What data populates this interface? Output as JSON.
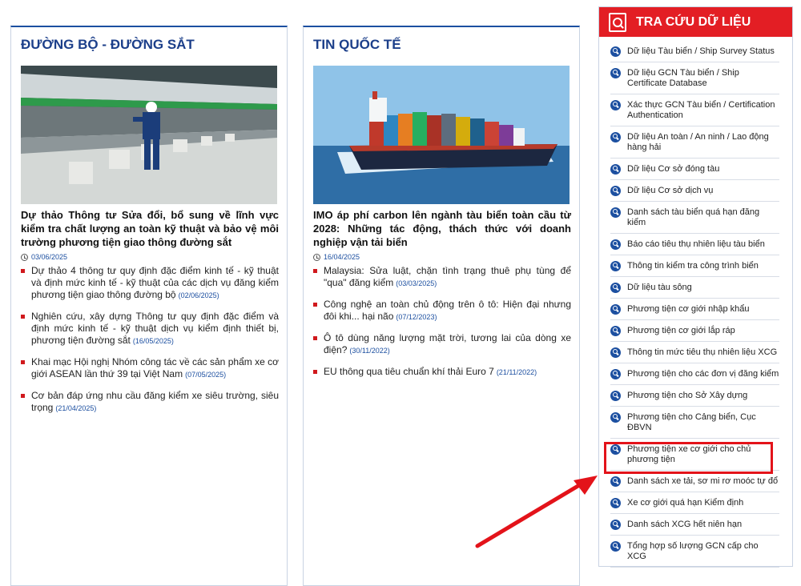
{
  "road_rail": {
    "title": "ĐƯỜNG BỘ - ĐƯỜNG SẮT",
    "lead_title": "Dự thảo Thông tư Sửa đổi, bổ sung về lĩnh vực kiểm tra chất lượng an toàn kỹ thuật và bảo vệ môi trường phương tiện giao thông đường sắt",
    "lead_date": "03/06/2025",
    "items": [
      {
        "text": "Dự thảo 4 thông tư quy định đặc điểm kinh tế - kỹ thuật và định mức kinh tế - kỹ thuật của các dịch vụ đăng kiểm phương tiện giao thông đường bộ",
        "date": "(02/06/2025)"
      },
      {
        "text": "Nghiên cứu, xây dựng Thông tư quy định đặc điểm và định mức kinh tế - kỹ thuật dịch vụ kiểm định thiết bị, phương tiện đường sắt",
        "date": "(16/05/2025)"
      },
      {
        "text": "Khai mạc Hội nghị Nhóm công tác về các sản phẩm xe cơ giới ASEAN lần thứ 39 tại Việt Nam",
        "date": "(07/05/2025)"
      },
      {
        "text": "Cơ bản đáp ứng nhu cầu đăng kiểm xe siêu trường, siêu trọng",
        "date": "(21/04/2025)"
      }
    ]
  },
  "international": {
    "title": "TIN QUỐC TẾ",
    "lead_title": "IMO áp phí carbon lên ngành tàu biển toàn cầu từ 2028: Những tác động, thách thức với doanh nghiệp vận tải biển",
    "lead_date": "16/04/2025",
    "items": [
      {
        "text": "Malaysia: Sửa luật, chặn tình trạng thuê phụ tùng để \"qua\" đăng kiểm",
        "date": "(03/03/2025)"
      },
      {
        "text": "Công nghệ an toàn chủ động trên ô tô: Hiện đại nhưng đôi khi... hại não",
        "date": "(07/12/2023)"
      },
      {
        "text": "Ô tô dùng năng lượng mặt trời, tương lai của dòng xe điện?",
        "date": "(30/11/2022)"
      },
      {
        "text": "EU thông qua tiêu chuẩn khí thải Euro 7",
        "date": "(21/11/2022)"
      }
    ]
  },
  "lookup": {
    "title": "TRA CỨU DỮ LIỆU",
    "items": [
      "Dữ liệu Tàu biển / Ship Survey Status",
      "Dữ liệu GCN Tàu biển / Ship Certificate Database",
      "Xác thực GCN Tàu biển / Certification Authentication",
      "Dữ liệu An toàn / An ninh / Lao động hàng hải",
      "Dữ liệu Cơ sở đóng tàu",
      "Dữ liệu Cơ sở dịch vụ",
      "Danh sách tàu biển quá hạn đăng kiểm",
      "Báo cáo tiêu thụ nhiên liệu tàu biển",
      "Thông tin kiểm tra công trình biển",
      "Dữ liệu tàu sông",
      "Phương tiện cơ giới nhập khẩu",
      "Phương tiện cơ giới lắp ráp",
      "Thông tin mức tiêu thụ nhiên liệu XCG",
      "Phương tiện cho các đơn vị đăng kiểm",
      "Phương tiện cho Sở Xây dựng",
      "Phương tiện cho Cảng biển, Cục ĐBVN",
      "Phương tiện xe cơ giới cho chủ phương tiện",
      "Danh sách xe tải, sơ mi rơ moóc tự đổ",
      "Xe cơ giới quá hạn Kiểm định",
      "Danh sách XCG hết niên hạn",
      "Tổng hợp số lượng GCN cấp cho XCG"
    ]
  },
  "colors": {
    "accent": "#1c4fa0",
    "brand_red": "#e31e24"
  }
}
